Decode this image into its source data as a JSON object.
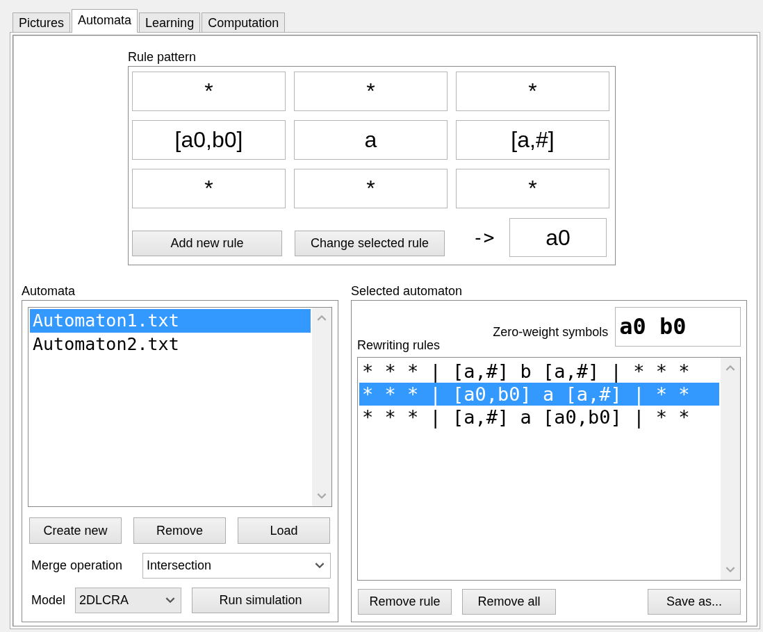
{
  "tabs": [
    {
      "label": "Pictures",
      "selected": false
    },
    {
      "label": "Automata",
      "selected": true
    },
    {
      "label": "Learning",
      "selected": false
    },
    {
      "label": "Computation",
      "selected": false
    }
  ],
  "rule_pattern": {
    "label": "Rule pattern",
    "cells": [
      [
        "*",
        "*",
        "*"
      ],
      [
        "[a0,b0]",
        "a",
        "[a,#]"
      ],
      [
        "*",
        "*",
        "*"
      ]
    ],
    "buttons": [
      "Add new rule",
      "Change selected rule"
    ],
    "arrow": "->",
    "result": "a0"
  },
  "automata": {
    "label": "Automata",
    "items": [
      {
        "text": "Automaton1.txt",
        "selected": true
      },
      {
        "text": "Automaton2.txt",
        "selected": false
      }
    ],
    "buttons": [
      "Create new",
      "Remove",
      "Load"
    ],
    "merge_label": "Merge operation",
    "merge_value": "Intersection",
    "model_label": "Model",
    "model_value": "2DLCRA",
    "run_button": "Run simulation"
  },
  "selected_automaton": {
    "label": "Selected automaton",
    "zero_weight_label": "Zero-weight symbols",
    "zero_weight_value": "a0 b0",
    "rules_label": "Rewriting rules",
    "rules": [
      {
        "text": "* * * | [a,#] b [a,#] | * * *",
        "selected": false
      },
      {
        "text": "* * * | [a0,b0] a [a,#] | * *",
        "selected": true
      },
      {
        "text": "* * * | [a,#] a [a0,b0] | * *",
        "selected": false
      }
    ],
    "buttons": [
      "Remove rule",
      "Remove all"
    ],
    "save_button": "Save as..."
  }
}
